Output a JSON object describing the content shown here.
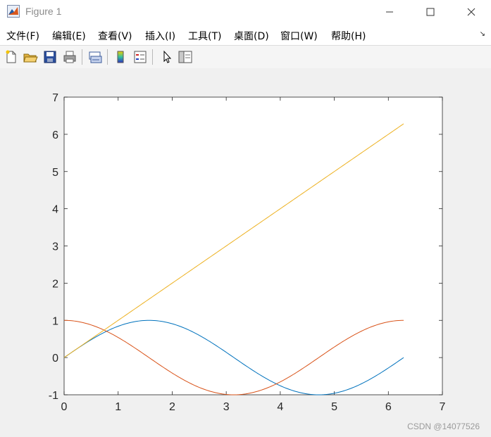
{
  "window": {
    "title": "Figure 1"
  },
  "menubar": {
    "items": [
      "文件(F)",
      "编辑(E)",
      "查看(V)",
      "插入(I)",
      "工具(T)",
      "桌面(D)",
      "窗口(W)",
      "帮助(H)"
    ]
  },
  "toolbar": {
    "icons": [
      "new-figure-icon",
      "open-file-icon",
      "save-icon",
      "print-icon",
      "link-plot-icon",
      "insert-colorbar-icon",
      "insert-legend-icon",
      "edit-plot-pointer-icon",
      "show-plot-tools-icon"
    ]
  },
  "chart_data": {
    "type": "line",
    "xlim": [
      0,
      7
    ],
    "ylim": [
      -1,
      7
    ],
    "xticks": [
      "0",
      "1",
      "2",
      "3",
      "4",
      "5",
      "6",
      "7"
    ],
    "yticks": [
      "-1",
      "0",
      "1",
      "2",
      "3",
      "4",
      "5",
      "6",
      "7"
    ],
    "grid": false,
    "series": [
      {
        "function": "sin(x)",
        "x_range": [
          0,
          6.2832
        ],
        "color": "#0072BD"
      },
      {
        "function": "cos(x)",
        "x_range": [
          0,
          6.2832
        ],
        "color": "#D95319"
      },
      {
        "function": "x",
        "x_range": [
          0,
          6.2832
        ],
        "color": "#EDB120"
      }
    ]
  },
  "watermark": "CSDN @14077526",
  "colors": {
    "axes_bg": "#ffffff",
    "figure_bg": "#f0f0f0",
    "axis_line": "#262626"
  }
}
